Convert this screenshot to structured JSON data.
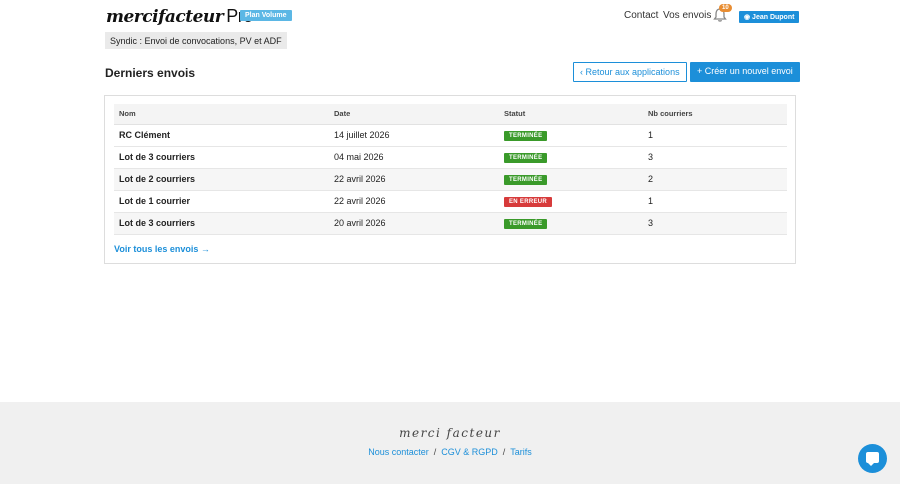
{
  "header": {
    "logo_text": "mercifacteur",
    "logo_suffix": "Pro",
    "plan_badge": "Plan Volume",
    "nav_contact": "Contact",
    "nav_envois": "Vos envois",
    "notification_count": "10",
    "user_badge": "◉ Jean Dupont"
  },
  "syndic_label": "Syndic : Envoi de convocations, PV et ADF",
  "section": {
    "title": "Derniers envois",
    "retour_label": "Retour aux applications",
    "create_label": "+ Créer un nouvel envoi"
  },
  "table": {
    "headers": {
      "nom": "Nom",
      "date": "Date",
      "statut": "Statut",
      "nb": "Nb courriers"
    },
    "rows": [
      {
        "nom": "RC Clément",
        "date": "14 juillet 2026",
        "statut": "TERMINÉE",
        "nb": "1"
      },
      {
        "nom": "Lot de 3 courriers",
        "date": "04 mai 2026",
        "statut": "TERMINÉE",
        "nb": "3"
      },
      {
        "nom": "Lot de 2 courriers",
        "date": "22 avril 2026",
        "statut": "TERMINÉE",
        "nb": "2"
      },
      {
        "nom": "Lot de 1 courrier",
        "date": "22 avril 2026",
        "statut": "EN ERREUR",
        "nb": "1"
      },
      {
        "nom": "Lot de 3 courriers",
        "date": "20 avril 2026",
        "statut": "TERMINÉE",
        "nb": "3"
      }
    ],
    "voir_tous": "Voir tous les envois →"
  },
  "footer": {
    "logo_text": "merci facteur",
    "links": [
      "Nous contacter",
      "CGV & RGPD",
      "Tarifs"
    ],
    "separator": "/"
  },
  "colors": {
    "accent": "#1c8fd9",
    "plan_badge": "#5bb7e5",
    "status_ok": "#3a9a2a",
    "status_error": "#d73b3b",
    "notification": "#e88d32"
  },
  "icons": [
    "bell-icon",
    "chevron-left-icon",
    "chat-icon"
  ]
}
